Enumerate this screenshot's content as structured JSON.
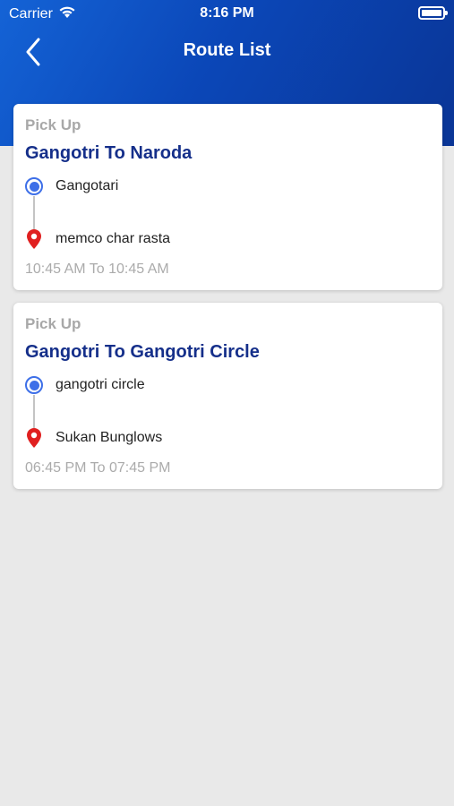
{
  "status_bar": {
    "carrier": "Carrier",
    "time": "8:16 PM"
  },
  "header": {
    "title": "Route List"
  },
  "routes": [
    {
      "type": "Pick Up",
      "title": "Gangotri To Naroda",
      "start": "Gangotari",
      "end": "memco char rasta",
      "time": "10:45 AM To 10:45 AM"
    },
    {
      "type": "Pick Up",
      "title": "Gangotri To Gangotri Circle",
      "start": "gangotri circle",
      "end": "Sukan Bunglows",
      "time": "06:45 PM To 07:45 PM"
    }
  ],
  "colors": {
    "header_start": "#1463d6",
    "header_end": "#0a3596",
    "title": "#152f8a",
    "start_dot": "#3d6fe8",
    "end_pin": "#e02020"
  },
  "icons": {
    "back": "chevron-left-icon",
    "start": "origin-dot-icon",
    "end": "map-pin-icon",
    "wifi": "wifi-icon",
    "battery": "battery-icon"
  }
}
